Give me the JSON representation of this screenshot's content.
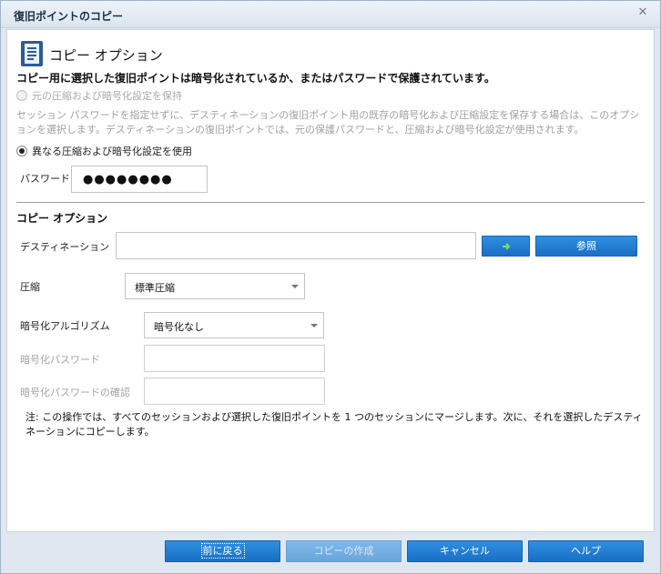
{
  "window": {
    "title": "復旧ポイントのコピー",
    "close_icon": "close-icon"
  },
  "header": {
    "icon": "document-icon",
    "title": "コピー オプション",
    "warning": "コピー用に選択した復旧ポイントは暗号化されているか、またはパスワードで保護されています。"
  },
  "options": {
    "keep_settings": {
      "label": "元の圧縮および暗号化設定を保持",
      "checked": false,
      "enabled": false
    },
    "keep_settings_description": "セッション パスワードを指定せずに、デスティネーションの復旧ポイント用の既存の暗号化および圧縮設定を保存する場合は、このオプションを選択します。デスティネーションの復旧ポイントでは、元の保護パスワードと、圧縮および暗号化設定が使用されます。",
    "different_settings": {
      "label": "異なる圧縮および暗号化設定を使用",
      "checked": true,
      "enabled": true
    },
    "password": {
      "label": "パスワード",
      "masked_value": "●●●●●●●●"
    }
  },
  "copy_options": {
    "heading": "コピー オプション",
    "destination": {
      "label": "デスティネーション",
      "value": "",
      "go_icon": "arrow-right-icon",
      "browse_label": "参照"
    },
    "compression": {
      "label": "圧縮",
      "selected": "標準圧縮"
    },
    "encryption_algorithm": {
      "label": "暗号化アルゴリズム",
      "selected": "暗号化なし"
    },
    "encryption_password": {
      "label": "暗号化パスワード",
      "value": ""
    },
    "encryption_password_confirm": {
      "label": "暗号化パスワードの確認",
      "value": ""
    },
    "note": "注: この操作では、すべてのセッションおよび選択した復旧ポイントを 1 つのセッションにマージします。次に、それを選択したデスティネーションにコピーします。"
  },
  "footer": {
    "back_label": "前に戻る",
    "create_copy_label": "コピーの作成",
    "cancel_label": "キャンセル",
    "help_label": "ヘルプ"
  },
  "colors": {
    "accent": "#1a6fc4",
    "background": "#dfe8f1"
  }
}
